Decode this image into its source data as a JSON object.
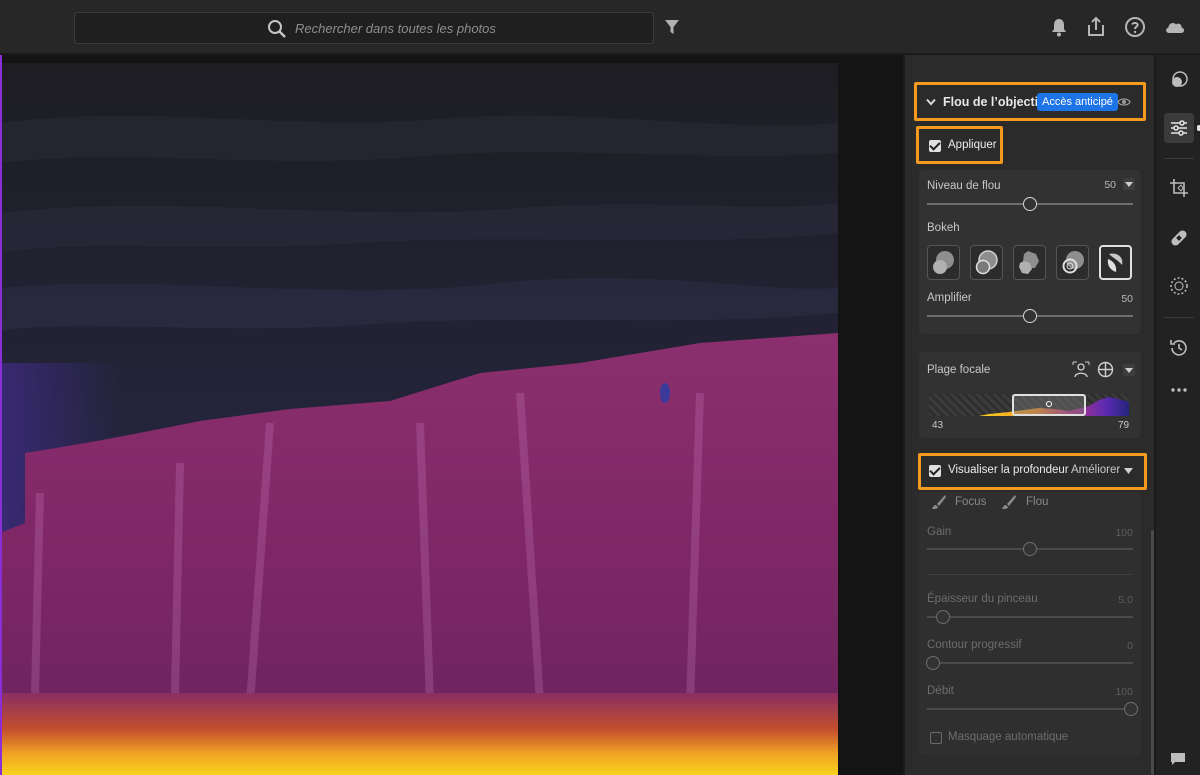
{
  "search": {
    "placeholder": "Rechercher dans toutes les photos"
  },
  "top_icons": [
    "filter-icon",
    "bell-icon",
    "share-icon",
    "help-icon",
    "cloud-icon"
  ],
  "lens_blur": {
    "title": "Flou de l’objectif",
    "badge": "Accès anticipé",
    "apply_label": "Appliquer",
    "apply_checked": true,
    "blur_amount": {
      "label": "Niveau de flou",
      "value": "50"
    },
    "bokeh": {
      "label": "Bokeh",
      "options": [
        "circle",
        "bubble",
        "blade",
        "ring",
        "cat-eye"
      ],
      "selected_index": 4
    },
    "boost": {
      "label": "Amplifier",
      "value": "50"
    },
    "focal_range": {
      "label": "Plage focale",
      "min": "43",
      "max": "79"
    },
    "visualize": {
      "label": "Visualiser la profondeur",
      "checked": true,
      "mode": "Améliorer"
    },
    "refine": {
      "focus_label": "Focus",
      "blur_label": "Flou",
      "amount": {
        "label": "Gain",
        "value": "100"
      },
      "size": {
        "label": "Épaisseur du pinceau",
        "value": "5.0"
      },
      "feather": {
        "label": "Contour progressif",
        "value": "0"
      },
      "flow": {
        "label": "Débit",
        "value": "100"
      },
      "auto_mask": {
        "label": "Masquage automatique",
        "checked": false
      }
    }
  },
  "slider_levels": {
    "blur_amount": 0.5,
    "boost": 0.5,
    "amount": 0.5,
    "size": 0.08,
    "feather": 0.03,
    "flow": 0.99
  },
  "rail_icons": [
    "edit-presets-icon",
    "adjust-icon",
    "crop-icon",
    "heal-icon",
    "masking-icon",
    "history-icon",
    "more-icon"
  ],
  "colors": {
    "accent": "#1d74e6",
    "highlight": "#f39a1f",
    "depth_near": "#f7c21c",
    "depth_mid": "#a0307a",
    "depth_far": "#3d2c6b"
  }
}
